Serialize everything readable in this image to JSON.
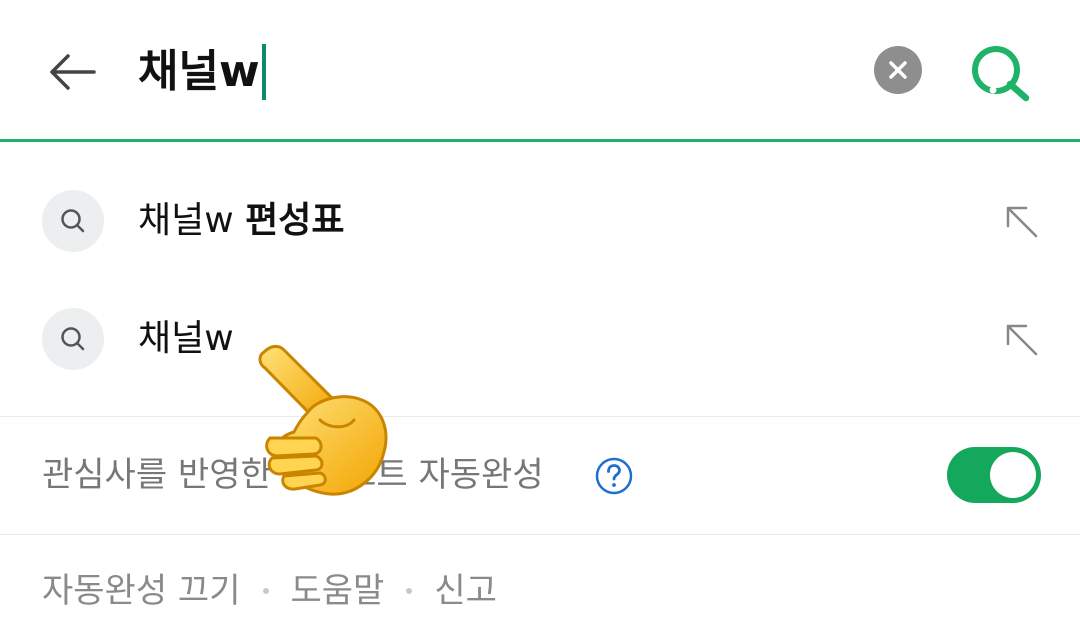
{
  "search": {
    "query": "채널w",
    "back_icon": "arrow-left-icon",
    "clear_icon": "close-circle-icon",
    "submit_icon": "search-icon",
    "accent_color": "#1fb36a"
  },
  "suggestions": [
    {
      "prefix": "채널w ",
      "highlight": "편성표",
      "icon": "search-icon",
      "action_icon": "arrow-up-left-icon"
    },
    {
      "prefix": "채널w",
      "highlight": "",
      "icon": "search-icon",
      "action_icon": "arrow-up-left-icon"
    }
  ],
  "autocomplete_setting": {
    "label": "관심사를 반영한 컨텍스트 자동완성",
    "help_icon": "question-circle-icon",
    "toggle_on": true,
    "toggle_color": "#13a85c"
  },
  "footer": {
    "links": [
      "자동완성 끄기",
      "도움말",
      "신고"
    ]
  },
  "overlay": {
    "icon": "pointing-hand-icon"
  }
}
